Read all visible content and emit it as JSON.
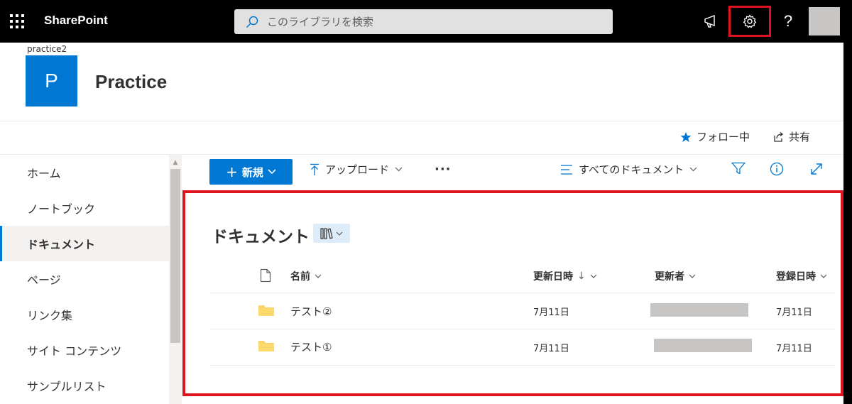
{
  "suitebar": {
    "brand": "SharePoint",
    "search_placeholder": "このライブラリを検索",
    "help_label": "?"
  },
  "site": {
    "url_label": "practice2",
    "logo_letter": "P",
    "title": "Practice",
    "follow_label": "フォロー中",
    "share_label": "共有"
  },
  "leftnav": {
    "items": [
      {
        "label": "ホーム",
        "active": false
      },
      {
        "label": "ノートブック",
        "active": false
      },
      {
        "label": "ドキュメント",
        "active": true
      },
      {
        "label": "ページ",
        "active": false
      },
      {
        "label": "リンク集",
        "active": false
      },
      {
        "label": "サイト コンテンツ",
        "active": false
      },
      {
        "label": "サンプルリスト",
        "active": false
      }
    ]
  },
  "commandbar": {
    "new_label": "新規",
    "upload_label": "アップロード",
    "more_label": "···",
    "view_label": "すべてのドキュメント"
  },
  "library": {
    "title": "ドキュメント",
    "columns": {
      "name": "名前",
      "modified": "更新日時",
      "modified_sort": "↓",
      "modified_by": "更新者",
      "created": "登録日時"
    },
    "rows": [
      {
        "name": "テスト②",
        "modified": "7月11日",
        "created": "7月11日"
      },
      {
        "name": "テスト①",
        "modified": "7月11日",
        "created": "7月11日"
      }
    ]
  },
  "colors": {
    "accent": "#0078d4",
    "highlight": "#e0141e",
    "folder": "#f8d36a"
  }
}
